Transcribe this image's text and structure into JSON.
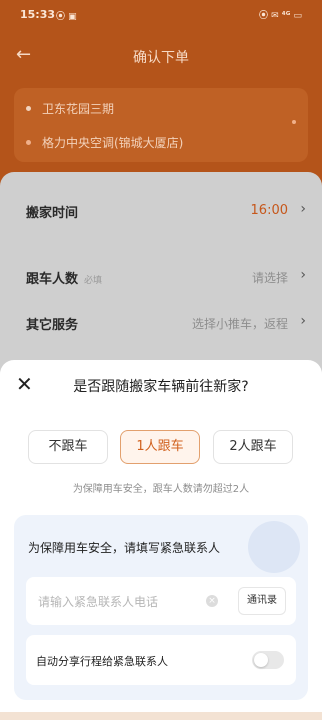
{
  "status_bar": {
    "time": "15:33",
    "left_icons": "⦿ ▣",
    "right_icons": "⦿ ✉ ⁴ᴳ ▭"
  },
  "nav": {
    "title": "确认下单",
    "back_icon": "back-arrow-icon"
  },
  "address": {
    "from": "卫东花园三期",
    "to": "格力中央空调(锦城大厦店)"
  },
  "service": {
    "rows": [
      {
        "label": "搬家时间",
        "value": "16:00",
        "chevron": "›"
      },
      {
        "label": "跟车人数",
        "required": "必填",
        "value": "请选择",
        "chevron": "›"
      },
      {
        "label": "其它服务",
        "value": "选择小推车，返程",
        "chevron": "›"
      }
    ]
  },
  "sheet": {
    "question": "是否跟随搬家车辆前往新家?",
    "close_icon": "close-icon",
    "options": [
      {
        "label": "不跟车",
        "selected": false
      },
      {
        "label": "1人跟车",
        "selected": true
      },
      {
        "label": "2人跟车",
        "selected": false
      }
    ],
    "hint": "为保障用车安全，跟车人数请勿超过2人"
  },
  "contact": {
    "title": "为保障用车安全，请填写紧急联系人",
    "phone_placeholder": "请输入紧急联系人电话",
    "address_book_label": "通讯录",
    "share_label": "自动分享行程给紧急联系人",
    "share_enabled": false
  },
  "colors": {
    "accent": "#c6571b",
    "orange_bg": "#b4541a"
  }
}
